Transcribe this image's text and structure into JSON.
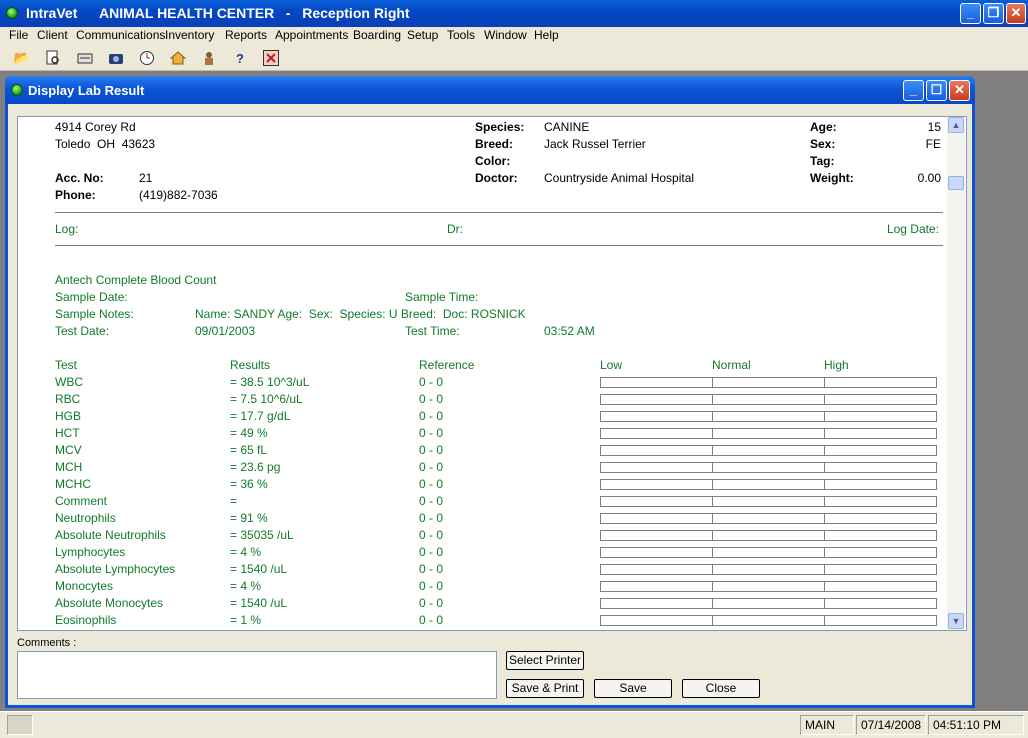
{
  "app": {
    "name": "IntraVet",
    "title": "ANIMAL HEALTH CENTER   -   Reception Right"
  },
  "menu": [
    "File",
    "Client",
    "Communications",
    "Inventory",
    "Reports",
    "Appointments",
    "Boarding",
    "Setup",
    "Tools",
    "Window",
    "Help"
  ],
  "toolbar_icons": [
    "open-folder-icon",
    "preview-icon",
    "card-icon",
    "camera-icon",
    "clock-icon",
    "home-icon",
    "vet-icon",
    "help-icon",
    "exit-icon"
  ],
  "window": {
    "title": "Display Lab Result"
  },
  "client": {
    "address1": "4914 Corey Rd",
    "address2": "Toledo  OH  43623",
    "acc_label": "Acc. No:",
    "acc_no": "21",
    "phone_label": "Phone:",
    "phone": "(419)882-7036"
  },
  "patient": {
    "species_label": "Species:",
    "species": "CANINE",
    "breed_label": "Breed:",
    "breed": "Jack Russel Terrier",
    "color_label": "Color:",
    "color": "",
    "doctor_label": "Doctor:",
    "doctor": "Countryside Animal Hospital",
    "age_label": "Age:",
    "age": "15",
    "sex_label": "Sex:",
    "sex": "FE",
    "tag_label": "Tag:",
    "tag": "",
    "weight_label": "Weight:",
    "weight": "0.00"
  },
  "log": {
    "log_label": "Log:",
    "dr_label": "Dr:",
    "date_label": "Log Date:"
  },
  "lab": {
    "title": "Antech Complete Blood Count",
    "sample_date_label": "Sample Date:",
    "sample_time_label": "Sample Time:",
    "sample_notes_label": "Sample Notes:",
    "sample_notes": "Name: SANDY Age:  Sex:  Species: U Breed:  Doc: ROSNICK",
    "test_date_label": "Test Date:",
    "test_date": "09/01/2003",
    "test_time_label": "Test Time:",
    "test_time": "03:52 AM"
  },
  "table": {
    "headers": {
      "test": "Test",
      "results": "Results",
      "reference": "Reference",
      "low": "Low",
      "normal": "Normal",
      "high": "High"
    },
    "rows": [
      {
        "test": "WBC",
        "result": "= 38.5 10^3/uL",
        "ref": "0 - 0"
      },
      {
        "test": "RBC",
        "result": "= 7.5 10^6/uL",
        "ref": "0 - 0"
      },
      {
        "test": "HGB",
        "result": "= 17.7 g/dL",
        "ref": "0 - 0"
      },
      {
        "test": "HCT",
        "result": "= 49 %",
        "ref": "0 - 0"
      },
      {
        "test": "MCV",
        "result": "= 65 fL",
        "ref": "0 - 0"
      },
      {
        "test": "MCH",
        "result": "= 23.6 pg",
        "ref": "0 - 0"
      },
      {
        "test": "MCHC",
        "result": "= 36 %",
        "ref": "0 - 0"
      },
      {
        "test": "Comment",
        "result": "=",
        "ref": "0 - 0"
      },
      {
        "test": "Neutrophils",
        "result": "= 91 %",
        "ref": "0 - 0"
      },
      {
        "test": "Absolute Neutrophils",
        "result": "= 35035 /uL",
        "ref": "0 - 0"
      },
      {
        "test": "Lymphocytes",
        "result": "= 4 %",
        "ref": "0 - 0"
      },
      {
        "test": "Absolute Lymphocytes",
        "result": "= 1540 /uL",
        "ref": "0 - 0"
      },
      {
        "test": "Monocytes",
        "result": "= 4 %",
        "ref": "0 - 0"
      },
      {
        "test": "Absolute Monocytes",
        "result": "= 1540 /uL",
        "ref": "0 - 0"
      },
      {
        "test": "Eosinophils",
        "result": "= 1 %",
        "ref": "0 - 0"
      }
    ]
  },
  "comments_label": "Comments :",
  "buttons": {
    "select_printer": "Select Printer",
    "save_print": "Save & Print",
    "save": "Save",
    "close": "Close"
  },
  "status": {
    "location": "MAIN",
    "date": "07/14/2008",
    "time": "04:51:10 PM"
  }
}
